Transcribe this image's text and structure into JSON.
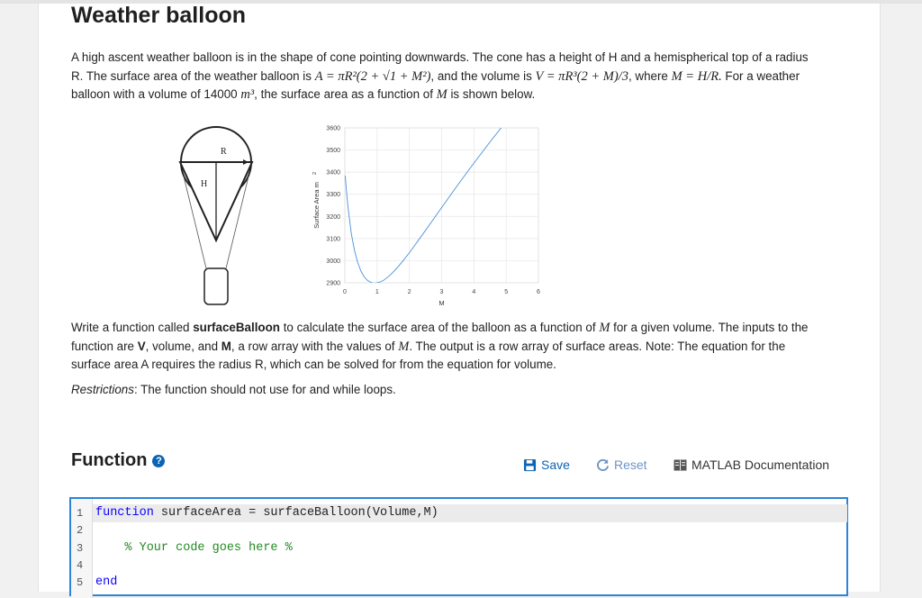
{
  "page": {
    "title": "Weather balloon",
    "intro": {
      "t1": "A high ascent weather balloon is in the shape of cone pointing downwards. The cone has a height of H and a hemispherical top of a radius R. The surface area of the weather balloon is ",
      "eqA": "A = πR²(2 + √1 + M²)",
      "t2": ", and the volume is ",
      "eqV": "V = πR³(2 + M)/3",
      "t3": ", where ",
      "eqM": "M = H/R.",
      "t4": " For a weather balloon with a volume of 14000 ",
      "unit": "m³",
      "t5": ", the surface area as a function of ",
      "varM": "M",
      "t6": " is shown below."
    },
    "task": {
      "t1": "Write a function called ",
      "fname": "surfaceBalloon",
      "t2": " to calculate the surface area of the balloon as a function of ",
      "varM": "M",
      "t3": " for a given volume.  The inputs to the function are ",
      "inV": "V",
      "t4": ", volume, and ",
      "inM": "M",
      "t5": ", a row array with the values of ",
      "varM2": "M",
      "t6": ".  The output is a row array of surface areas.  Note: The equation for the surface area A requires the radius R, which can be solved for from the equation for volume."
    },
    "restrictions": {
      "label": "Restrictions",
      "text": ":  The function should not use for and while loops."
    }
  },
  "diagram": {
    "label_r": "R",
    "label_h": "H"
  },
  "chart_data": {
    "type": "line",
    "title": "",
    "xlabel": "M",
    "ylabel": "Surface Area m",
    "ylabel_sup": "2",
    "xlim": [
      0,
      6
    ],
    "ylim": [
      2900,
      3600
    ],
    "xticks": [
      "0",
      "1",
      "2",
      "3",
      "4",
      "5",
      "6"
    ],
    "yticks": [
      "2900",
      "3000",
      "3100",
      "3200",
      "3300",
      "3400",
      "3500",
      "3600"
    ],
    "grid": true,
    "line_color": "#4a90d9",
    "series": [
      {
        "x": [
          0.01,
          0.05,
          0.1,
          0.2,
          0.3,
          0.4,
          0.5,
          0.6,
          0.7,
          0.8,
          0.9,
          1.0,
          1.1,
          1.2,
          1.4,
          1.6,
          1.8,
          2.0,
          2.5,
          3.0,
          3.5,
          4.0,
          4.5,
          5.0,
          5.5,
          6.0
        ],
        "values": [
          3384,
          3315,
          3238,
          3122,
          3045,
          2991,
          2953,
          2927,
          2911,
          2902,
          2898,
          2900,
          2904,
          2911,
          2934,
          2964,
          2999,
          3036,
          3137,
          3240,
          3342,
          3441,
          3537,
          3629,
          3718,
          3804
        ]
      }
    ]
  },
  "function_section": {
    "title": "Function",
    "help_icon": "?",
    "save_label": "Save",
    "reset_label": "Reset",
    "doc_label": "MATLAB Documentation"
  },
  "editor": {
    "line_numbers": [
      "1",
      "2",
      "3",
      "4",
      "5"
    ],
    "line1_kw": "function",
    "line1_rest": " surfaceArea = surfaceBalloon(Volume,M)",
    "line3": "    % Your code goes here %",
    "line5_kw": "end"
  }
}
